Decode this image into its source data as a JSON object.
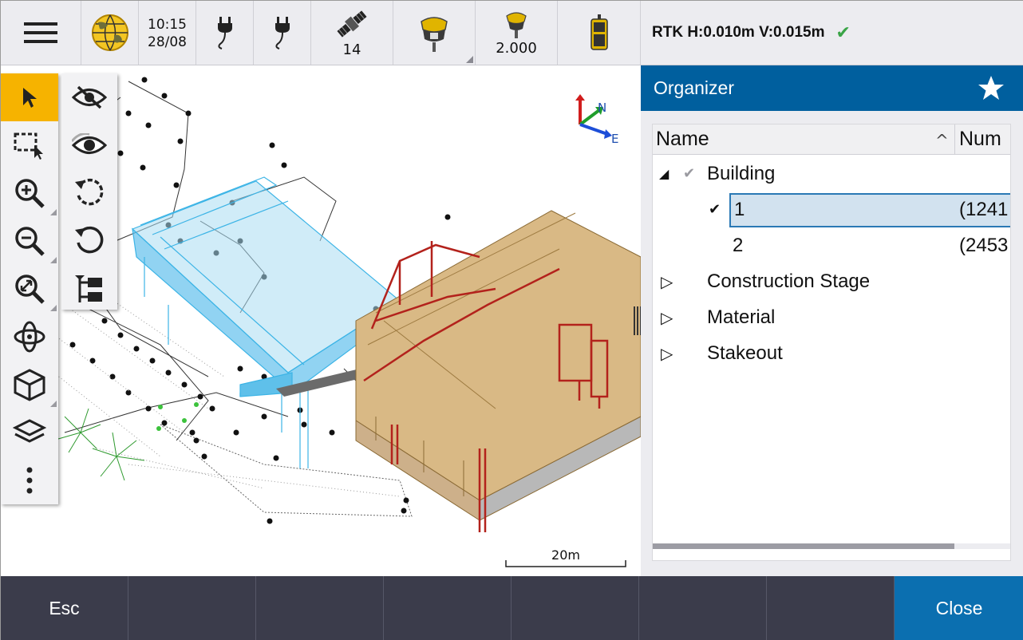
{
  "statusbar": {
    "time": "10:15",
    "date": "28/08",
    "satellites": "14",
    "antenna_height": "2.000",
    "icons": [
      "menu-icon",
      "globe-icon",
      "power-plug-icon",
      "power-plug-icon",
      "satellite-icon",
      "gnss-receiver-icon",
      "gnss-receiver-icon",
      "controller-icon"
    ]
  },
  "rtk": {
    "text": "RTK H:0.010m V:0.015m",
    "status_icon": "check-icon",
    "status_color": "#3aa447"
  },
  "map": {
    "north_label": "N",
    "east_label": "E",
    "scale_label": "20m",
    "structure_colors": {
      "steel_blue": "#3cb4e6",
      "timber": "#c8a46e",
      "red_frame": "#b3221c"
    }
  },
  "toolbar_left": [
    "select-icon",
    "box-select-icon",
    "zoom-in-icon",
    "zoom-out-icon",
    "zoom-extents-icon",
    "orbit-icon",
    "view-cube-icon",
    "layers-icon",
    "more-icon"
  ],
  "toolbar_right": [
    "hide-icon",
    "show-icon",
    "rotate-ccw-icon",
    "rotate-cw-icon",
    "tree-icon"
  ],
  "organizer": {
    "title": "Organizer",
    "columns": {
      "name": "Name",
      "num": "Num"
    },
    "rows": [
      {
        "label": "Building",
        "expand": "◢",
        "check": "✔"
      },
      {
        "label": "1",
        "value": "(1241",
        "check": "✔"
      },
      {
        "label": "2",
        "value": "(2453"
      },
      {
        "label": "Construction Stage",
        "expand": "▷"
      },
      {
        "label": "Material",
        "expand": "▷"
      },
      {
        "label": "Stakeout",
        "expand": "▷"
      }
    ]
  },
  "bottom": {
    "esc": "Esc",
    "close": "Close"
  },
  "colors": {
    "accent_blue": "#005f9e",
    "active_tool": "#f6b300",
    "bottom_bar": "#3b3c4b"
  }
}
